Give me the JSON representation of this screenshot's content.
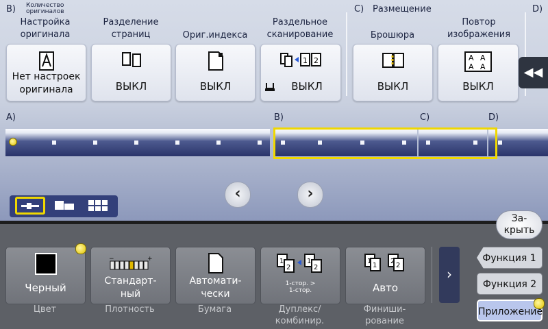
{
  "sections": {
    "b_label": "B)",
    "count_label": "Количество\nоригиналов",
    "c_label": "C)",
    "c_title": "Размещение",
    "d_label": "D)"
  },
  "functions": [
    {
      "title": "Настройка\nоригинала",
      "value": "Нет настроек\nоригинала",
      "icon": "original-setting-icon"
    },
    {
      "title": "Разделение\nстраниц",
      "value": "ВЫКЛ",
      "icon": "page-separation-icon"
    },
    {
      "title": "Ориг.индекса",
      "value": "ВЫКЛ",
      "icon": "index-original-icon"
    },
    {
      "title": "Раздельное\nсканирование",
      "value": "ВЫКЛ",
      "icon": "separate-scan-icon"
    },
    {
      "title": "Брошюра",
      "value": "ВЫКЛ",
      "icon": "booklet-icon"
    },
    {
      "title": "Повтор\nизображения",
      "value": "ВЫКЛ",
      "icon": "image-repeat-icon",
      "glyph": "A"
    }
  ],
  "position": {
    "a": "A)",
    "b": "B)",
    "c": "C)",
    "d": "D)"
  },
  "close_button": "За-\nкрыть",
  "quick": [
    {
      "value": "Черный",
      "caption": "Цвет",
      "icon": "black-square-icon"
    },
    {
      "value": "Стандарт-\nный",
      "caption": "Плотность",
      "icon": "density-scale-icon"
    },
    {
      "value": "Автомати-\nчески",
      "caption": "Бумага",
      "icon": "paper-icon"
    },
    {
      "value": "1-стор. >\n1-стор.",
      "caption": "Дуплекс/\nкомбинир.",
      "icon": "duplex-icon"
    },
    {
      "value": "Авто",
      "caption": "Финиши-\nрование",
      "icon": "finishing-icon"
    }
  ],
  "tabs": [
    "Функция 1",
    "Функция 2",
    "Приложение"
  ],
  "colors": {
    "highlight": "#f0d800",
    "tab_active": "#b9c6ec"
  }
}
